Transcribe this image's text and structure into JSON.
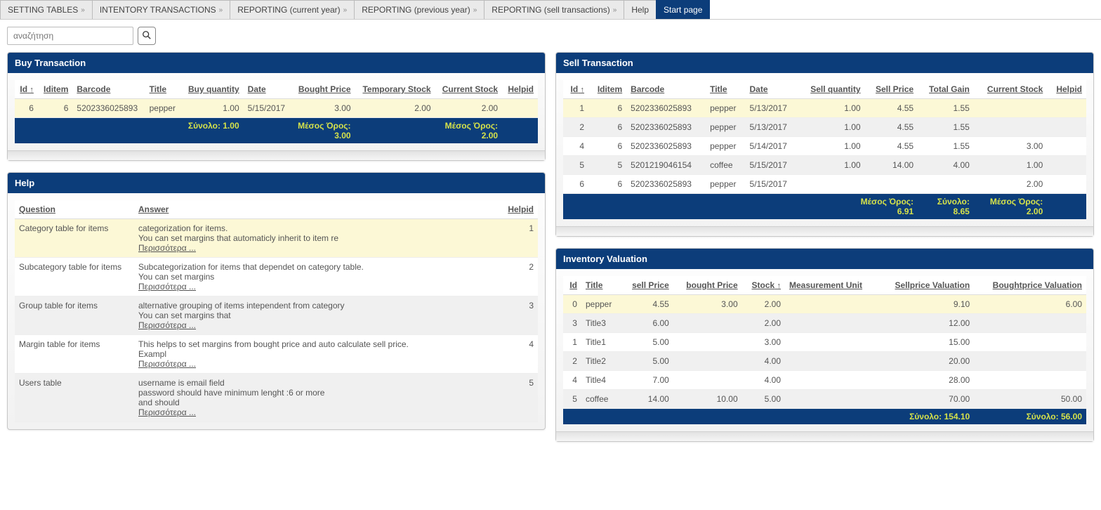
{
  "nav": {
    "items": [
      {
        "label": "SETTING TABLES"
      },
      {
        "label": "INTENTORY TRANSACTIONS"
      },
      {
        "label": "REPORTING (current year)"
      },
      {
        "label": "REPORTING (previous year)"
      },
      {
        "label": "REPORTING (sell transactions)"
      },
      {
        "label": "Help"
      },
      {
        "label": "Start page"
      }
    ],
    "active_index": 6
  },
  "search": {
    "placeholder": "αναζήτηση"
  },
  "buy": {
    "title": "Buy Transaction",
    "headers": [
      "Id",
      "Iditem",
      "Barcode",
      "Title",
      "Buy quantity",
      "Date",
      "Bought Price",
      "Temporary Stock",
      "Current Stock",
      "Helpid"
    ],
    "sort_col": "Id",
    "rows": [
      {
        "id": "6",
        "iditem": "6",
        "barcode": "5202336025893",
        "title": "pepper",
        "buyqty": "1.00",
        "date": "5/15/2017",
        "bprice": "3.00",
        "tstock": "2.00",
        "cstock": "2.00",
        "helpid": ""
      }
    ],
    "summary": {
      "buyqty_label": "Σύνολο:",
      "buyqty_val": "1.00",
      "bprice_label": "Μέσος Όρος:",
      "bprice_val": "3.00",
      "cstock_label": "Μέσος Όρος:",
      "cstock_val": "2.00"
    }
  },
  "sell": {
    "title": "Sell Transaction",
    "headers": [
      "Id",
      "Iditem",
      "Barcode",
      "Title",
      "Date",
      "Sell quantity",
      "Sell Price",
      "Total Gain",
      "Current Stock",
      "Helpid"
    ],
    "sort_col": "Id",
    "rows": [
      {
        "id": "1",
        "iditem": "6",
        "barcode": "5202336025893",
        "title": "pepper",
        "date": "5/13/2017",
        "sqty": "1.00",
        "sprice": "4.55",
        "gain": "1.55",
        "cstock": "",
        "helpid": ""
      },
      {
        "id": "2",
        "iditem": "6",
        "barcode": "5202336025893",
        "title": "pepper",
        "date": "5/13/2017",
        "sqty": "1.00",
        "sprice": "4.55",
        "gain": "1.55",
        "cstock": "",
        "helpid": ""
      },
      {
        "id": "4",
        "iditem": "6",
        "barcode": "5202336025893",
        "title": "pepper",
        "date": "5/14/2017",
        "sqty": "1.00",
        "sprice": "4.55",
        "gain": "1.55",
        "cstock": "3.00",
        "helpid": ""
      },
      {
        "id": "5",
        "iditem": "5",
        "barcode": "5201219046154",
        "title": "coffee",
        "date": "5/15/2017",
        "sqty": "1.00",
        "sprice": "14.00",
        "gain": "4.00",
        "cstock": "1.00",
        "helpid": ""
      },
      {
        "id": "6",
        "iditem": "6",
        "barcode": "5202336025893",
        "title": "pepper",
        "date": "5/15/2017",
        "sqty": "",
        "sprice": "",
        "gain": "",
        "cstock": "2.00",
        "helpid": ""
      }
    ],
    "summary": {
      "sprice_label": "Μέσος Όρος:",
      "sprice_val": "6.91",
      "gain_label": "Σύνολο:",
      "gain_val": "8.65",
      "cstock_label": "Μέσος Όρος:",
      "cstock_val": "2.00"
    }
  },
  "help": {
    "title": "Help",
    "headers": [
      "Question",
      "Answer",
      "Helpid"
    ],
    "more_label": "Περισσότερα ...",
    "rows": [
      {
        "q": "Category table for items",
        "a": "categorization for items.\nYou can set margins that automaticly inherit to item re",
        "id": "1"
      },
      {
        "q": "Subcategory table for items",
        "a": "Subcategorization for items that dependet on category table.\nYou can set margins",
        "id": "2"
      },
      {
        "q": "Group table for items",
        "a": "alternative grouping of items intependent from category\nYou can set margins that",
        "id": "3"
      },
      {
        "q": "Margin table for items",
        "a": "This helps to set margins from bought price and auto calculate sell price.\nExampl",
        "id": "4"
      },
      {
        "q": "Users table",
        "a": "username is email field\npassword should have minimum lenght :6 or more\nand should",
        "id": "5"
      }
    ]
  },
  "inv": {
    "title": "Inventory Valuation",
    "headers": [
      "Id",
      "Title",
      "sell Price",
      "bought Price",
      "Stock",
      "Measurement Unit",
      "Sellprice Valuation",
      "Boughtprice Valuation"
    ],
    "sort_col": "Stock",
    "rows": [
      {
        "id": "0",
        "title": "pepper",
        "sp": "4.55",
        "bp": "3.00",
        "stock": "2.00",
        "mu": "",
        "sv": "9.10",
        "bv": "6.00"
      },
      {
        "id": "3",
        "title": "Title3",
        "sp": "6.00",
        "bp": "",
        "stock": "2.00",
        "mu": "",
        "sv": "12.00",
        "bv": ""
      },
      {
        "id": "1",
        "title": "Title1",
        "sp": "5.00",
        "bp": "",
        "stock": "3.00",
        "mu": "",
        "sv": "15.00",
        "bv": ""
      },
      {
        "id": "2",
        "title": "Title2",
        "sp": "5.00",
        "bp": "",
        "stock": "4.00",
        "mu": "",
        "sv": "20.00",
        "bv": ""
      },
      {
        "id": "4",
        "title": "Title4",
        "sp": "7.00",
        "bp": "",
        "stock": "4.00",
        "mu": "",
        "sv": "28.00",
        "bv": ""
      },
      {
        "id": "5",
        "title": "coffee",
        "sp": "14.00",
        "bp": "10.00",
        "stock": "5.00",
        "mu": "",
        "sv": "70.00",
        "bv": "50.00"
      }
    ],
    "summary": {
      "sv_label": "Σύνολο:",
      "sv_val": "154.10",
      "bv_label": "Σύνολο:",
      "bv_val": "56.00"
    }
  }
}
